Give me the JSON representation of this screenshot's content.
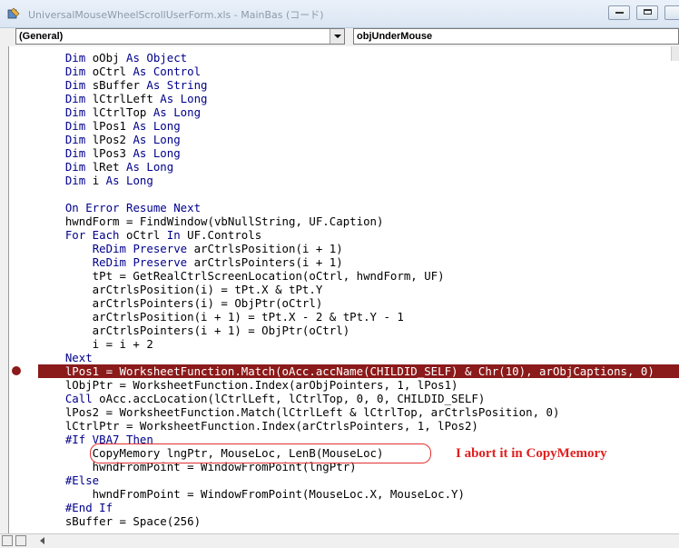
{
  "window": {
    "title": "UniversalMouseWheelScrollUserForm.xls - MainBas (コード)"
  },
  "toolbar": {
    "object_combo": "(General)",
    "procedure_combo": "objUnderMouse"
  },
  "code": {
    "lines": [
      [
        {
          "t": "    "
        },
        {
          "t": "Dim",
          "k": 1
        },
        {
          "t": " oObj "
        },
        {
          "t": "As Object",
          "k": 1
        }
      ],
      [
        {
          "t": "    "
        },
        {
          "t": "Dim",
          "k": 1
        },
        {
          "t": " oCtrl "
        },
        {
          "t": "As Control",
          "k": 1
        }
      ],
      [
        {
          "t": "    "
        },
        {
          "t": "Dim",
          "k": 1
        },
        {
          "t": " sBuffer "
        },
        {
          "t": "As String",
          "k": 1
        }
      ],
      [
        {
          "t": "    "
        },
        {
          "t": "Dim",
          "k": 1
        },
        {
          "t": " lCtrlLeft "
        },
        {
          "t": "As Long",
          "k": 1
        }
      ],
      [
        {
          "t": "    "
        },
        {
          "t": "Dim",
          "k": 1
        },
        {
          "t": " lCtrlTop "
        },
        {
          "t": "As Long",
          "k": 1
        }
      ],
      [
        {
          "t": "    "
        },
        {
          "t": "Dim",
          "k": 1
        },
        {
          "t": " lPos1 "
        },
        {
          "t": "As Long",
          "k": 1
        }
      ],
      [
        {
          "t": "    "
        },
        {
          "t": "Dim",
          "k": 1
        },
        {
          "t": " lPos2 "
        },
        {
          "t": "As Long",
          "k": 1
        }
      ],
      [
        {
          "t": "    "
        },
        {
          "t": "Dim",
          "k": 1
        },
        {
          "t": " lPos3 "
        },
        {
          "t": "As Long",
          "k": 1
        }
      ],
      [
        {
          "t": "    "
        },
        {
          "t": "Dim",
          "k": 1
        },
        {
          "t": " lRet "
        },
        {
          "t": "As Long",
          "k": 1
        }
      ],
      [
        {
          "t": "    "
        },
        {
          "t": "Dim",
          "k": 1
        },
        {
          "t": " i "
        },
        {
          "t": "As Long",
          "k": 1
        }
      ],
      [
        {
          "t": ""
        }
      ],
      [
        {
          "t": "    "
        },
        {
          "t": "On Error Resume Next",
          "k": 1
        }
      ],
      [
        {
          "t": "    hwndForm = FindWindow(vbNullString, UF.Caption)"
        }
      ],
      [
        {
          "t": "    "
        },
        {
          "t": "For Each",
          "k": 1
        },
        {
          "t": " oCtrl "
        },
        {
          "t": "In",
          "k": 1
        },
        {
          "t": " UF.Controls"
        }
      ],
      [
        {
          "t": "        "
        },
        {
          "t": "ReDim Preserve",
          "k": 1
        },
        {
          "t": " arCtrlsPosition(i + 1)"
        }
      ],
      [
        {
          "t": "        "
        },
        {
          "t": "ReDim Preserve",
          "k": 1
        },
        {
          "t": " arCtrlsPointers(i + 1)"
        }
      ],
      [
        {
          "t": "        tPt = GetRealCtrlScreenLocation(oCtrl, hwndForm, UF)"
        }
      ],
      [
        {
          "t": "        arCtrlsPosition(i) = tPt.X & tPt.Y"
        }
      ],
      [
        {
          "t": "        arCtrlsPointers(i) = ObjPtr(oCtrl)"
        }
      ],
      [
        {
          "t": "        arCtrlsPosition(i + 1) = tPt.X - 2 & tPt.Y - 1"
        }
      ],
      [
        {
          "t": "        arCtrlsPointers(i + 1) = ObjPtr(oCtrl)"
        }
      ],
      [
        {
          "t": "        i = i + 2"
        }
      ],
      [
        {
          "t": "    "
        },
        {
          "t": "Next",
          "k": 1
        }
      ],
      [
        {
          "t": "    lPos1 = WorksheetFunction.Match(oAcc.accName(CHILDID_SELF) & Chr(10), arObjCaptions, 0)"
        }
      ],
      [
        {
          "t": "    lObjPtr = WorksheetFunction.Index(arObjPointers, 1, lPos1)"
        }
      ],
      [
        {
          "t": "    "
        },
        {
          "t": "Call",
          "k": 1
        },
        {
          "t": " oAcc.accLocation(lCtrlLeft, lCtrlTop, 0, 0, CHILDID_SELF)"
        }
      ],
      [
        {
          "t": "    lPos2 = WorksheetFunction.Match(lCtrlLeft & lCtrlTop, arCtrlsPosition, 0)"
        }
      ],
      [
        {
          "t": "    lCtrlPtr = WorksheetFunction.Index(arCtrlsPointers, 1, lPos2)"
        }
      ],
      [
        {
          "t": "    "
        },
        {
          "t": "#If VBA7 Then",
          "k": 1
        }
      ],
      [
        {
          "t": "        CopyMemory lngPtr, MouseLoc, LenB(MouseLoc)"
        }
      ],
      [
        {
          "t": "        hwndFromPoint = WindowFromPoint(lngPtr)"
        }
      ],
      [
        {
          "t": "    "
        },
        {
          "t": "#Else",
          "k": 1
        }
      ],
      [
        {
          "t": "        hwndFromPoint = WindowFromPoint(MouseLoc.X, MouseLoc.Y)"
        }
      ],
      [
        {
          "t": "    "
        },
        {
          "t": "#End If",
          "k": 1
        }
      ],
      [
        {
          "t": "    sBuffer = Space(256)"
        }
      ]
    ],
    "highlighted_line": 23
  },
  "annotation": {
    "text": "I abort it in CopyMemory",
    "color": "#e02020"
  },
  "colors": {
    "keyword": "#00008b",
    "breakpoint": "#8b1a1a"
  }
}
